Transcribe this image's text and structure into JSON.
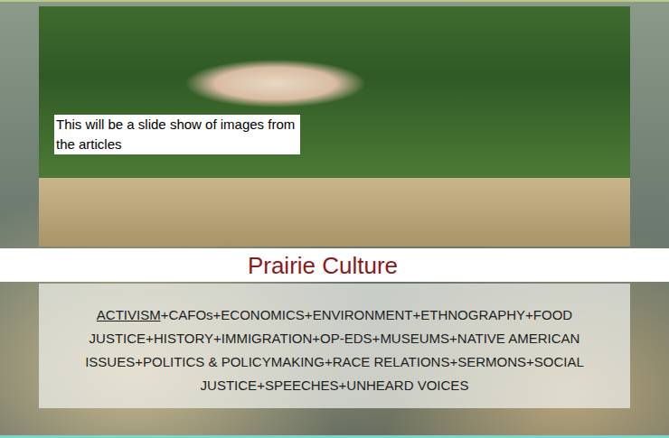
{
  "hero": {
    "caption": "This will be a slide show of images from the articles"
  },
  "site_title": "Prairie Culture",
  "categories": {
    "separator": "+",
    "items": [
      {
        "label": "ACTIVISM",
        "selected": true
      },
      {
        "label": "CAFOs",
        "selected": false
      },
      {
        "label": "ECONOMICS",
        "selected": false
      },
      {
        "label": "ENVIRONMENT",
        "selected": false
      },
      {
        "label": "ETHNOGRAPHY",
        "selected": false
      },
      {
        "label": "FOOD JUSTICE",
        "selected": false
      },
      {
        "label": "HISTORY",
        "selected": false
      },
      {
        "label": "IMMIGRATION",
        "selected": false
      },
      {
        "label": "OP-EDS",
        "selected": false
      },
      {
        "label": "MUSEUMS",
        "selected": false
      },
      {
        "label": "NATIVE AMERICAN ISSUES",
        "selected": false
      },
      {
        "label": "POLITICS & POLICYMAKING",
        "selected": false
      },
      {
        "label": "RACE RELATIONS",
        "selected": false
      },
      {
        "label": "SERMONS",
        "selected": false
      },
      {
        "label": "SOCIAL JUSTICE",
        "selected": false
      },
      {
        "label": "SPEECHES",
        "selected": false
      },
      {
        "label": "UNHEARD VOICES",
        "selected": false
      }
    ]
  }
}
